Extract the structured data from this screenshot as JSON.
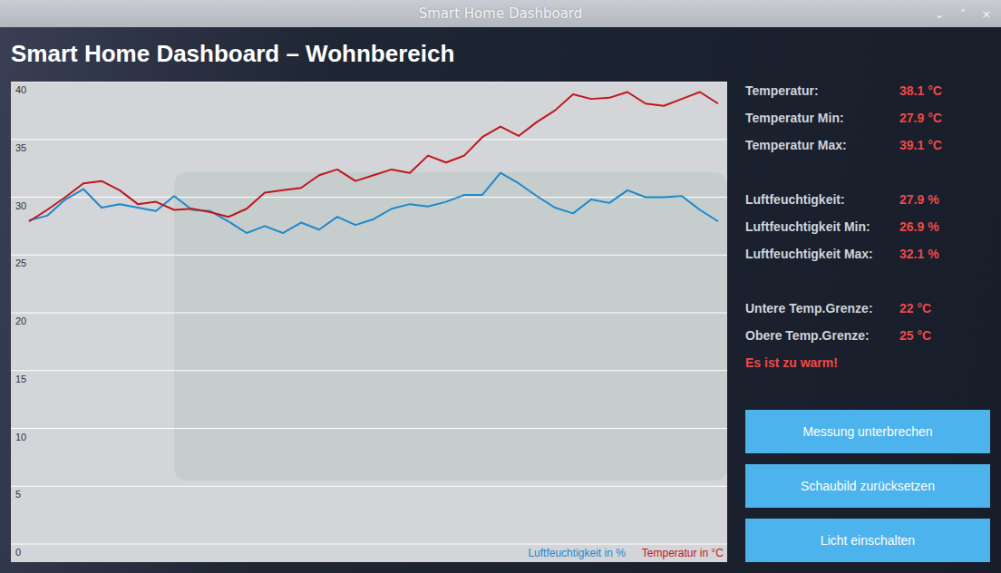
{
  "window": {
    "title": "Smart Home Dashboard",
    "controls": [
      "⌄",
      "˄",
      "×"
    ]
  },
  "heading": "Smart Home Dashboard – Wohnbereich",
  "chart": {
    "ticks": [
      "40",
      "35",
      "30",
      "25",
      "20",
      "15",
      "10",
      "5",
      "0"
    ],
    "series": [
      {
        "name": "Luftfeuchtigkeit in %",
        "color": "#1f88cc",
        "values": [
          28.0,
          28.4,
          29.8,
          30.7,
          29.1,
          29.4,
          29.1,
          28.8,
          30.1,
          28.9,
          28.8,
          27.9,
          26.9,
          27.5,
          26.9,
          27.8,
          27.2,
          28.3,
          27.6,
          28.1,
          29.0,
          29.4,
          29.2,
          29.6,
          30.2,
          30.2,
          32.1,
          31.2,
          30.1,
          29.1,
          28.6,
          29.8,
          29.5,
          30.6,
          30.0,
          30.0,
          30.1,
          28.9,
          27.9
        ]
      },
      {
        "name": "Temperatur in °C",
        "color": "#c0171a",
        "values": [
          27.9,
          28.9,
          30.0,
          31.2,
          31.4,
          30.6,
          29.4,
          29.6,
          28.9,
          29.0,
          28.7,
          28.3,
          29.0,
          30.4,
          30.6,
          30.8,
          31.9,
          32.4,
          31.4,
          31.9,
          32.4,
          32.1,
          33.6,
          33.0,
          33.6,
          35.2,
          36.1,
          35.3,
          36.5,
          37.5,
          38.9,
          38.5,
          38.6,
          39.1,
          38.1,
          37.9,
          38.5,
          39.1,
          38.1
        ]
      }
    ]
  },
  "stats": [
    {
      "rows": [
        {
          "label": "Temperatur:",
          "value": "38.1 °C"
        },
        {
          "label": "Temperatur Min:",
          "value": "27.9 °C"
        },
        {
          "label": "Temperatur Max:",
          "value": "39.1 °C"
        }
      ]
    },
    {
      "rows": [
        {
          "label": "Luftfeuchtigkeit:",
          "value": "27.9 %"
        },
        {
          "label": "Luftfeuchtigkeit Min:",
          "value": "26.9 %"
        },
        {
          "label": "Luftfeuchtigkeit Max:",
          "value": "32.1 %"
        }
      ]
    },
    {
      "rows": [
        {
          "label": "Untere Temp.Grenze:",
          "value": "22 °C"
        },
        {
          "label": "Obere Temp.Grenze:",
          "value": "25 °C"
        }
      ]
    }
  ],
  "alert": "Es ist zu warm!",
  "buttons": [
    "Messung unterbrechen",
    "Schaubild zurücksetzen",
    "Licht einschalten"
  ]
}
